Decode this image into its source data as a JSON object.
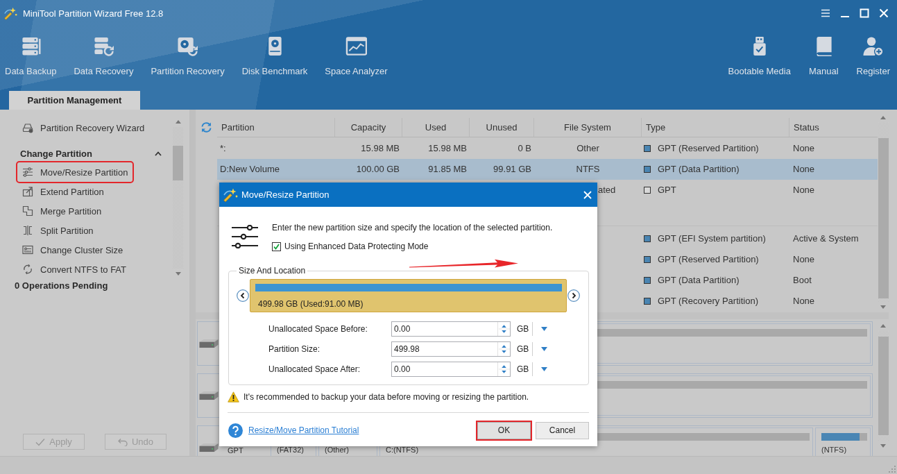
{
  "window": {
    "title": "MiniTool Partition Wizard Free 12.8"
  },
  "toolbar": {
    "left": [
      {
        "label": "Data Backup",
        "kind": "backup"
      },
      {
        "label": "Data Recovery",
        "kind": "data_recovery"
      },
      {
        "label": "Partition Recovery",
        "kind": "partition_recovery"
      },
      {
        "label": "Disk Benchmark",
        "kind": "benchmark"
      },
      {
        "label": "Space Analyzer",
        "kind": "analyzer"
      }
    ],
    "right": [
      {
        "label": "Bootable Media",
        "kind": "bootable"
      },
      {
        "label": "Manual",
        "kind": "manual"
      },
      {
        "label": "Register",
        "kind": "register"
      }
    ]
  },
  "tabs": [
    {
      "label": "Partition Management",
      "selected": true
    }
  ],
  "sidebar": {
    "wizard": {
      "label": "Partition Recovery Wizard"
    },
    "section": {
      "title": "Change Partition",
      "expanded": true,
      "items": [
        {
          "label": "Move/Resize Partition",
          "kind": "move",
          "highlighted": true
        },
        {
          "label": "Extend Partition",
          "kind": "extend",
          "highlighted": false
        },
        {
          "label": "Merge Partition",
          "kind": "merge",
          "highlighted": false
        },
        {
          "label": "Split Partition",
          "kind": "split",
          "highlighted": false
        },
        {
          "label": "Change Cluster Size",
          "kind": "cluster",
          "highlighted": false
        },
        {
          "label": "Convert NTFS to FAT",
          "kind": "convert",
          "highlighted": false
        }
      ]
    },
    "operations_pending": "0 Operations Pending",
    "buttons": [
      {
        "label": "Apply",
        "kind": "apply",
        "disabled": true
      },
      {
        "label": "Undo",
        "kind": "undo",
        "disabled": true
      }
    ]
  },
  "partition_table": {
    "columns": [
      "Partition",
      "Capacity",
      "Used",
      "Unused",
      "File System",
      "Type",
      "Status"
    ],
    "groups": [
      {
        "rows": [
          {
            "kind": "full",
            "partition": "*:",
            "capacity": "15.98 MB",
            "used": "15.98 MB",
            "unused": "0 B",
            "file_system": "Other",
            "type": "GPT (Reserved Partition)",
            "color": "#4a85b2",
            "status": "None",
            "selected": false
          },
          {
            "kind": "full",
            "partition": "D:New Volume",
            "capacity": "100.00 GB",
            "used": "91.85 MB",
            "unused": "99.91 GB",
            "file_system": "NTFS",
            "type": "GPT (Data Partition)",
            "color": "#4a85b2",
            "status": "None",
            "selected": true
          },
          {
            "kind": "clipped",
            "file_system": "ated",
            "type": "GPT",
            "color": "#d8d8d8",
            "status": "None",
            "selected": false
          }
        ]
      },
      {
        "rows": [
          {
            "kind": "clipped",
            "type": "GPT (EFI System partition)",
            "color": "#4a85b2",
            "status": "Active & System",
            "selected": false
          },
          {
            "kind": "clipped",
            "type": "GPT (Reserved Partition)",
            "color": "#4a85b2",
            "status": "None",
            "selected": false
          },
          {
            "kind": "clipped",
            "type": "GPT (Data Partition)",
            "color": "#4a85b2",
            "status": "Boot",
            "selected": false
          },
          {
            "kind": "clipped",
            "type": "GPT (Recovery Partition)",
            "color": "#4a85b2",
            "status": "None",
            "selected": false
          }
        ]
      }
    ]
  },
  "disk_map": {
    "disks": [
      {
        "partitions": [
          {
            "kind": "plain"
          }
        ]
      },
      {
        "partitions": [
          {
            "kind": "plain"
          }
        ]
      },
      {
        "type": "GPT",
        "partitions": [
          {
            "kind": "plain",
            "label": "(FAT32)"
          },
          {
            "kind": "plain",
            "label": "(Other)"
          },
          {
            "kind": "plain",
            "label": "C:(NTFS)"
          },
          {
            "kind": "usage",
            "label": "(NTFS)",
            "level": 0.83
          }
        ]
      }
    ]
  },
  "dialog": {
    "title": "Move/Resize Partition",
    "description": "Enter the new partition size and specify the location of the selected partition.",
    "protect_mode": {
      "label": "Using Enhanced Data Protecting Mode",
      "checked": true
    },
    "group_title": "Size And Location",
    "partition_block": {
      "label": "499.98 GB (Used:91.00 MB)"
    },
    "fields": [
      {
        "label": "Unallocated Space Before:",
        "value": "0.00",
        "unit": "GB"
      },
      {
        "label": "Partition Size:",
        "value": "499.98",
        "unit": "GB"
      },
      {
        "label": "Unallocated Space After:",
        "value": "0.00",
        "unit": "GB"
      }
    ],
    "warning": "It's recommended to backup your data before moving or resizing the partition.",
    "tutorial_link": "Resize/Move Partition Tutorial",
    "buttons": [
      {
        "label": "OK",
        "highlighted": true
      },
      {
        "label": "Cancel",
        "highlighted": false
      }
    ]
  }
}
